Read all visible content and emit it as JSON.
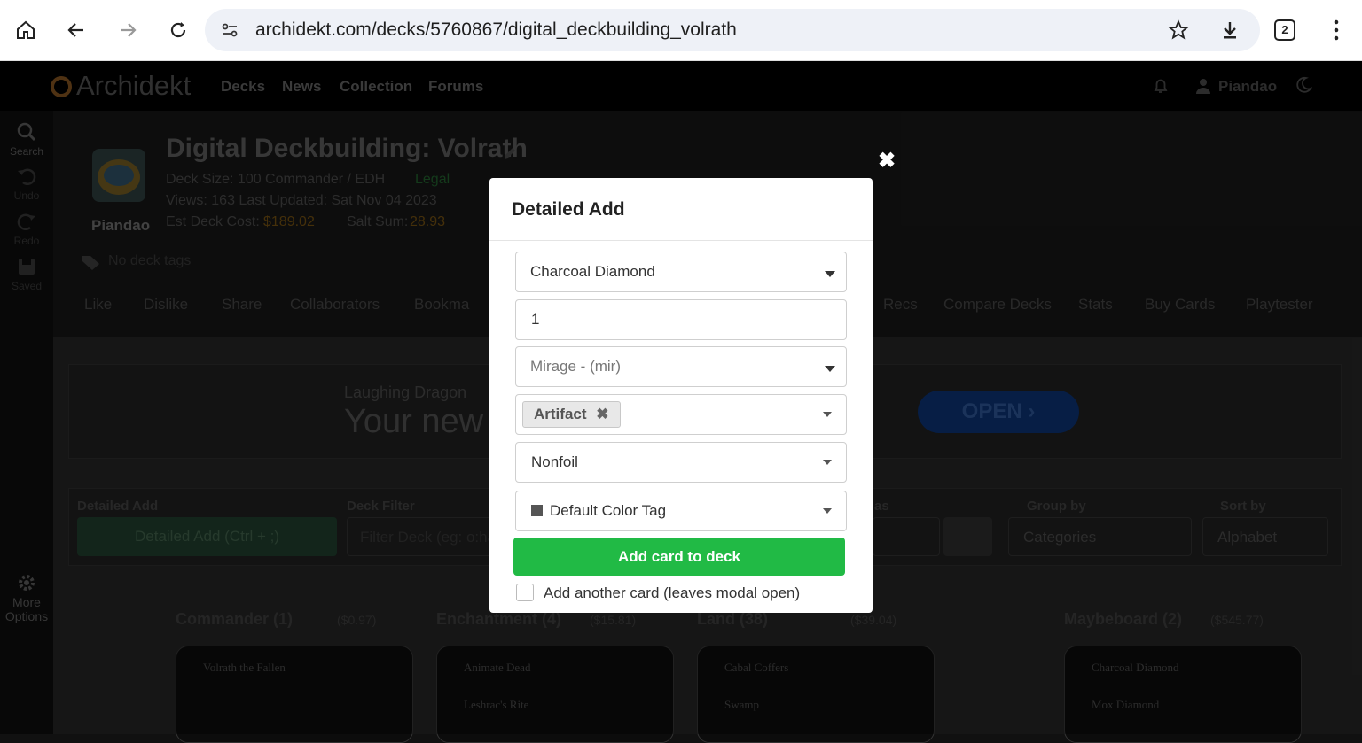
{
  "browser": {
    "url": "archidekt.com/decks/5760867/digital_deckbuilding_volrath",
    "tab_count": "2"
  },
  "nav": {
    "brand": "Archidekt",
    "links": [
      "Decks",
      "News",
      "Collection",
      "Forums"
    ],
    "user": "Piandao"
  },
  "sidebar": {
    "search": "Search",
    "undo": "Undo",
    "redo": "Redo",
    "saved": "Saved",
    "more_line1": "More",
    "more_line2": "Options"
  },
  "deck": {
    "title": "Digital Deckbuilding: Volrath",
    "owner": "Piandao",
    "size_line": "Deck Size: 100   Commander / EDH",
    "legal": "Legal",
    "views_line": "Views: 163   Last Updated: Sat Nov 04 2023",
    "cost_label": "Est Deck Cost:",
    "cost_value": "$189.02",
    "salt_label": "Salt Sum:",
    "salt_value": "28.93",
    "tags": "No deck tags"
  },
  "actions": [
    "Like",
    "Dislike",
    "Share",
    "Collaborators",
    "Bookma",
    "Recs",
    "Compare Decks",
    "Stats",
    "Buy Cards",
    "Playtester"
  ],
  "ad": {
    "brand": "Laughing Dragon",
    "headline": "Your new",
    "button": "OPEN"
  },
  "toolbar": {
    "detailed_add_label": "Detailed Add",
    "detailed_add_button": "Detailed Add (Ctrl + ;)",
    "deck_filter_label": "Deck Filter",
    "deck_filter_placeholder": "Filter Deck (eg: o:ha",
    "view_as_label": "as",
    "group_by_label": "Group by",
    "group_by_value": "Categories",
    "sort_by_label": "Sort by",
    "sort_by_value": "Alphabet"
  },
  "columns": [
    {
      "name": "Commander (1)",
      "price": "($0.97)",
      "cards": [
        "Volrath the Fallen"
      ]
    },
    {
      "name": "Enchantment (4)",
      "price": "($15.81)",
      "cards": [
        "Animate Dead",
        "Leshrac's Rite"
      ]
    },
    {
      "name": "Land (38)",
      "price": "($39.04)",
      "cards": [
        "Cabal Coffers",
        "Swamp"
      ]
    },
    {
      "name": "Maybeboard (2)",
      "price": "($545.77)",
      "cards": [
        "Charcoal Diamond",
        "Mox Diamond"
      ]
    }
  ],
  "modal": {
    "title": "Detailed Add",
    "card_name": "Charcoal Diamond",
    "quantity": "1",
    "edition": "Mirage - (mir)",
    "category_chip": "Artifact",
    "foil": "Nonfoil",
    "color_tag": "Default Color Tag",
    "add_button": "Add card to deck",
    "keep_open_label": "Add another card (leaves modal open)",
    "colors": {
      "add_button": "#21ba45",
      "tag_swatch": "#555555"
    }
  }
}
